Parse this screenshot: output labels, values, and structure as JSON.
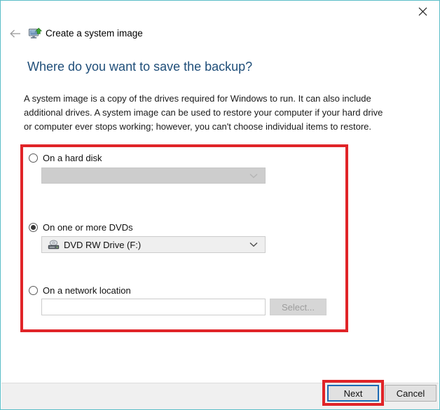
{
  "window": {
    "accent_border_color": "#5bbec8",
    "close_label": "✕",
    "close_icon": "close-icon",
    "back_icon": "back-arrow-icon"
  },
  "header": {
    "app_icon": "system-image-monitor-icon",
    "title": "Create a system image"
  },
  "page": {
    "heading": "Where do you want to save the backup?",
    "heading_color": "#1f4e79",
    "body": "A system image is a copy of the drives required for Windows to run. It can also include additional drives. A system image can be used to restore your computer if your hard drive or computer ever stops working; however, you can't choose individual items to restore."
  },
  "options": [
    {
      "id": "hard-disk",
      "label": "On a hard disk",
      "selected": false,
      "control": {
        "type": "combobox",
        "value": "",
        "disabled": true,
        "icon": ""
      }
    },
    {
      "id": "dvds",
      "label": "On one or more DVDs",
      "selected": true,
      "control": {
        "type": "combobox",
        "value": "DVD RW Drive (F:)",
        "disabled": false,
        "icon": "optical-drive-icon"
      }
    },
    {
      "id": "network-location",
      "label": "On a network location",
      "selected": false,
      "control": {
        "type": "textfield",
        "value": "",
        "placeholder": "",
        "disabled": false
      },
      "button": {
        "label": "Select...",
        "disabled": true
      }
    }
  ],
  "footer": {
    "next_label": "Next",
    "cancel_label": "Cancel"
  },
  "annotations": {
    "color": "#e02428",
    "options_box": "options-highlight",
    "next_box": "next-button-highlight"
  }
}
